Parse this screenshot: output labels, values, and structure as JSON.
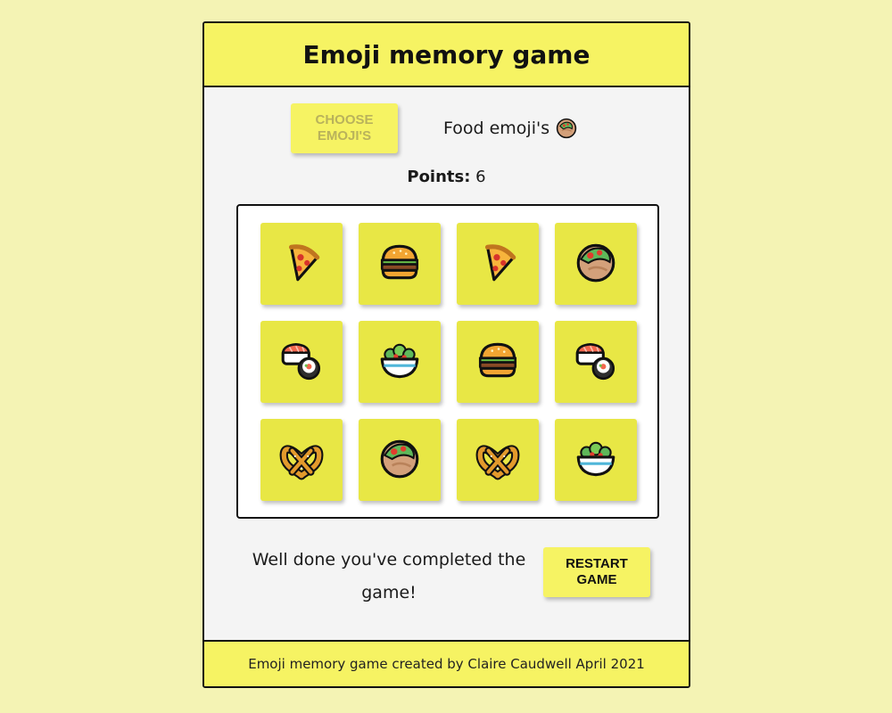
{
  "header": {
    "title": "Emoji memory game"
  },
  "controls": {
    "choose_label": "Choose emoji's",
    "selected_set_label": "Food emoji's",
    "selected_set_icon": "falafel-icon"
  },
  "score": {
    "label": "Points:",
    "value": "6"
  },
  "cards": [
    {
      "icon": "pizza-icon"
    },
    {
      "icon": "hamburger-icon"
    },
    {
      "icon": "pizza-icon"
    },
    {
      "icon": "falafel-icon"
    },
    {
      "icon": "sushi-icon"
    },
    {
      "icon": "salad-icon"
    },
    {
      "icon": "hamburger-icon"
    },
    {
      "icon": "sushi-icon"
    },
    {
      "icon": "pretzel-icon"
    },
    {
      "icon": "falafel-icon"
    },
    {
      "icon": "pretzel-icon"
    },
    {
      "icon": "salad-icon"
    }
  ],
  "status": {
    "message": "Well done you've completed the game!",
    "restart_label": "Restart game"
  },
  "footer": {
    "text": "Emoji memory game created by Claire Caudwell April 2021"
  },
  "colors": {
    "page_background": "#f4f3b4",
    "accent_yellow": "#f6f363",
    "card_yellow": "#e8e745",
    "panel_background": "#f4f4f4"
  }
}
